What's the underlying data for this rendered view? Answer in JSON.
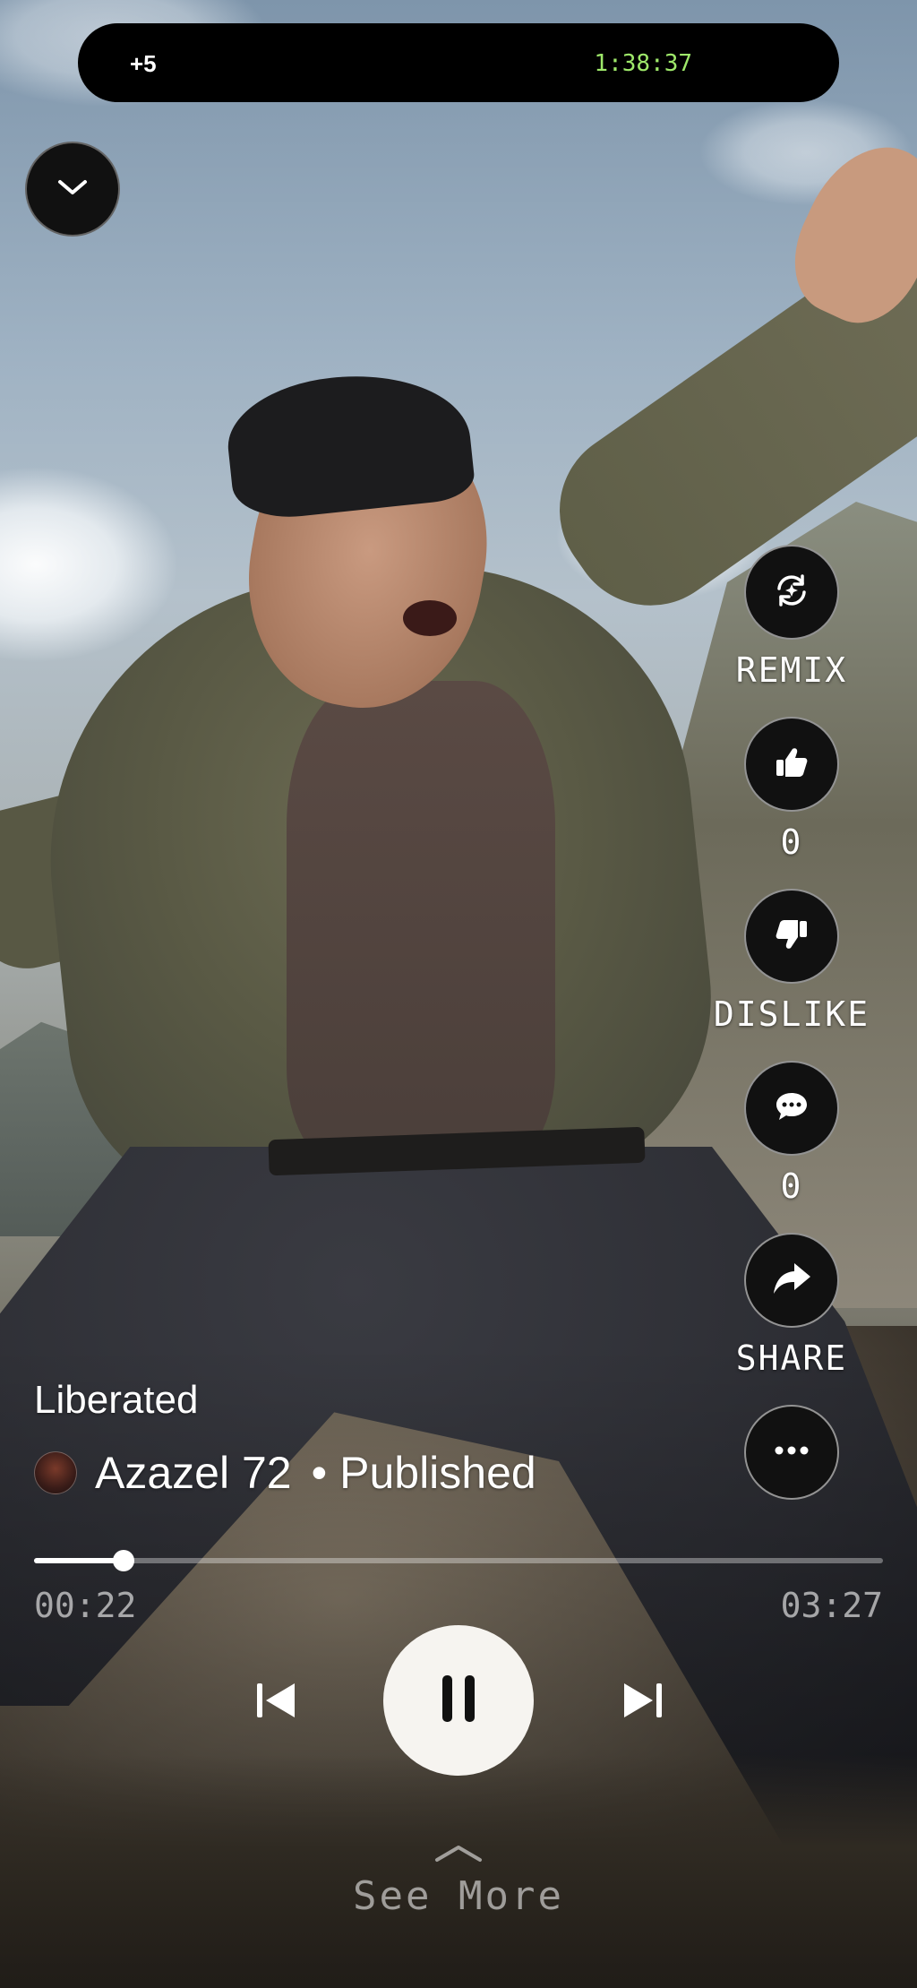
{
  "status_bar": {
    "left_text": "+5",
    "right_text": "1:38:37"
  },
  "actions": {
    "remix": {
      "label": "REMIX",
      "icon": "remix-icon"
    },
    "like": {
      "label": "0",
      "icon": "thumbs-up-icon"
    },
    "dislike": {
      "label": "DISLIKE",
      "icon": "thumbs-down-icon"
    },
    "comment": {
      "label": "0",
      "icon": "comment-icon"
    },
    "share": {
      "label": "SHARE",
      "icon": "share-icon"
    },
    "more": {
      "icon": "more-icon"
    }
  },
  "track": {
    "title": "Liberated",
    "artist": "Azazel 72",
    "separator": "•",
    "status": "Published"
  },
  "playback": {
    "current_time": "00:22",
    "duration": "03:27",
    "progress": 0.106,
    "state": "playing"
  },
  "see_more": {
    "label": "See More"
  },
  "colors": {
    "accent_time": "#9ee86a",
    "button_bg": "#111111",
    "play_bg": "#f6f4f0"
  }
}
